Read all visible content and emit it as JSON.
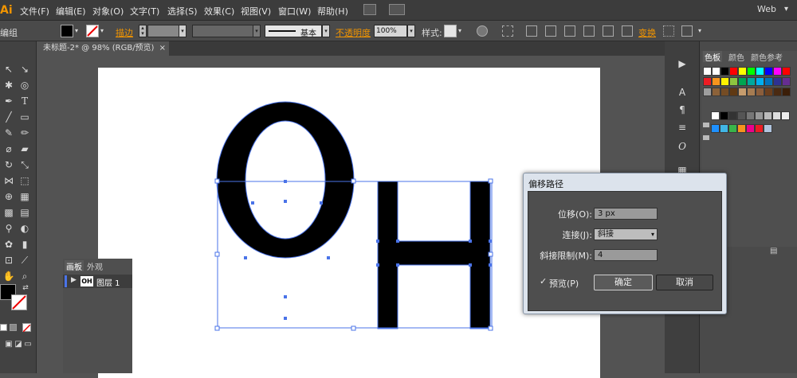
{
  "app": {
    "logo": "Ai",
    "workspace": "Web"
  },
  "menu": [
    "文件(F)",
    "编辑(E)",
    "对象(O)",
    "文字(T)",
    "选择(S)",
    "效果(C)",
    "视图(V)",
    "窗口(W)",
    "帮助(H)"
  ],
  "control_bar": {
    "context": "编组",
    "stroke_label": "描边",
    "stroke_style": "基本",
    "opacity_label": "不透明度",
    "opacity_value": "100%",
    "style_label": "样式:",
    "transform_label": "变换"
  },
  "document": {
    "tab_title": "未标题-2* @ 98% (RGB/预览)",
    "close": "×"
  },
  "artwork": {
    "text": "OH"
  },
  "swatches_panel": {
    "tabs": [
      "色板",
      "颜色",
      "颜色参考"
    ],
    "row1": [
      "#ffffff",
      "#ffffff",
      "#000000",
      "#ff0000",
      "#ffff00",
      "#00ff00",
      "#00ffff",
      "#0000ff",
      "#ff00ff",
      "#ff0000"
    ],
    "row2": [
      "#ed1c24",
      "#f7941d",
      "#fff200",
      "#8dc63f",
      "#00a651",
      "#00a99d",
      "#00aeef",
      "#0072bc",
      "#2e3192",
      "#662d91"
    ],
    "row3": [
      "#9e9e9e",
      "#8c6239",
      "#754c24",
      "#603913",
      "#c69c6d",
      "#a67c52",
      "#8b5e3c",
      "#6b3f1e",
      "#4a2a12",
      "#3b1e08"
    ],
    "row4": [
      "#ffffff",
      "#000000",
      "#333333",
      "#555555",
      "#777777",
      "#999999",
      "#bbbbbb",
      "#dddddd",
      "#eeeeee"
    ],
    "row5": [
      "#1e90ff",
      "#41b6e6",
      "#39b54a",
      "#f7941d",
      "#ec008c",
      "#ed1c24",
      "#b0c4de"
    ]
  },
  "layers_panel": {
    "tabs": [
      "画板",
      "外观"
    ],
    "layer_name": "图层 1"
  },
  "dialog": {
    "title": "偏移路径",
    "offset_label": "位移(O):",
    "offset_value": "3 px",
    "join_label": "连接(J):",
    "join_value": "斜接",
    "miter_label": "斜接限制(M):",
    "miter_value": "4",
    "preview_label": "预览(P)",
    "ok_label": "确定",
    "cancel_label": "取消"
  },
  "colors": {
    "accent_orange": "#f29500",
    "selection_blue": "#4a73e8"
  }
}
